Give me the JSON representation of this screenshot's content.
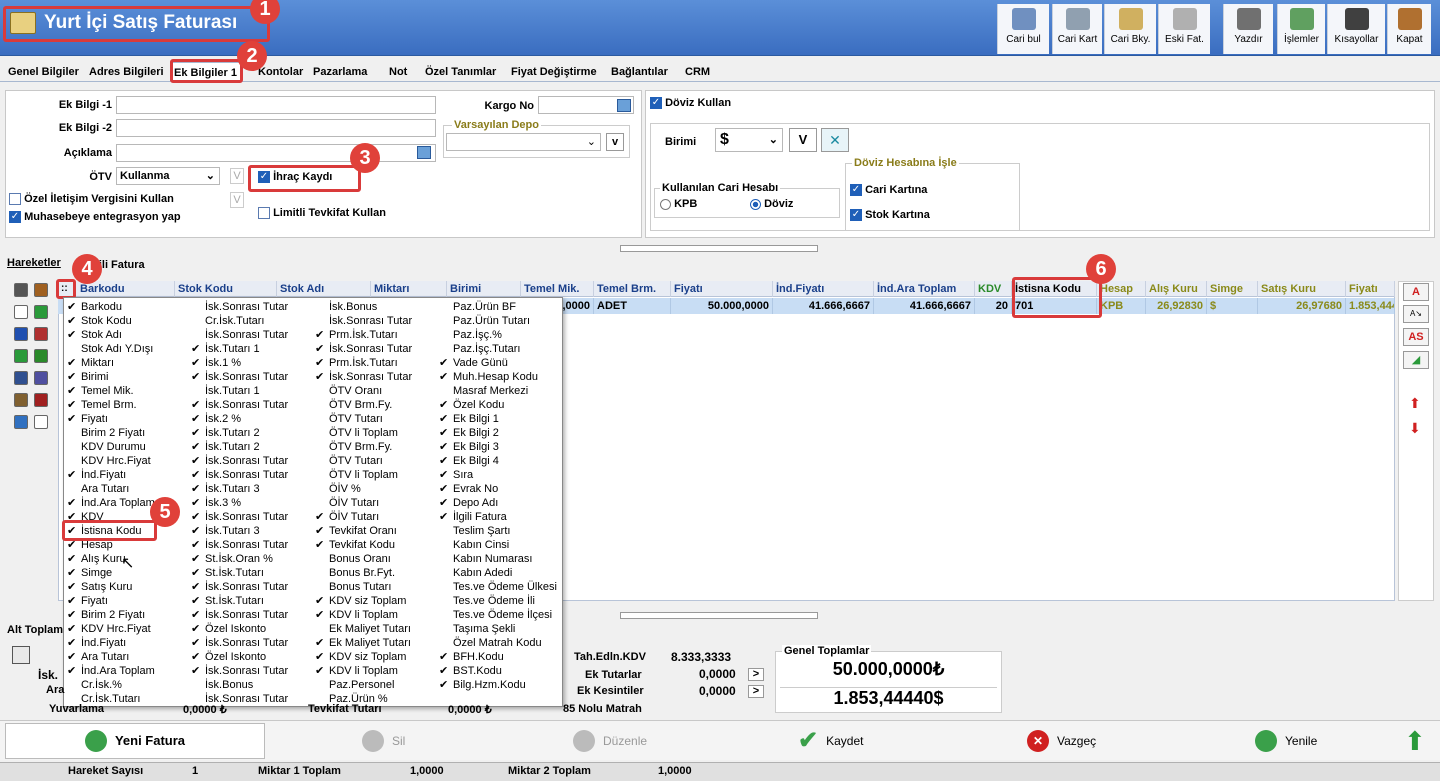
{
  "window": {
    "title": "Yurt İçi Satış Faturası"
  },
  "toolbar": [
    {
      "label": "Cari bul",
      "icon": "user-search-icon"
    },
    {
      "label": "Cari Kart",
      "icon": "users-icon"
    },
    {
      "label": "Cari Bky.",
      "icon": "document-user-icon"
    },
    {
      "label": "Eski Fat.",
      "icon": "old-invoice-icon"
    },
    {
      "label": "Yazdır",
      "icon": "printer-icon"
    },
    {
      "label": "İşlemler",
      "icon": "operations-icon"
    },
    {
      "label": "Kısayollar",
      "icon": "keyboard-icon"
    },
    {
      "label": "Kapat",
      "icon": "door-icon"
    }
  ],
  "tabs": [
    "Genel Bilgiler",
    "Adres Bilgileri",
    "Ek Bilgiler 1",
    "Kontolar",
    "Pazarlama",
    "Not",
    "Özel Tanımlar",
    "Fiyat Değiştirme",
    "Bağlantılar",
    "CRM"
  ],
  "form": {
    "ek1": "Ek Bilgi -1",
    "ek2": "Ek Bilgi -2",
    "aciklama": "Açıklama",
    "otv": "ÖTV",
    "otv_value": "Kullanma",
    "ozel": "Özel İletişim Vergisini Kullan",
    "muh": "Muhasebeye entegrasyon yap",
    "ihrac": "İhraç Kaydı",
    "limitli": "Limitli Tevkifat Kullan",
    "kargo": "Kargo No",
    "depo": "Varsayılan Depo",
    "v": "V",
    "vlow": "v"
  },
  "doviz": {
    "title": "Döviz Kullan",
    "birimi": "Birimi",
    "currency": "$",
    "kullanilan": "Kullanılan Cari Hesabı",
    "kpb": "KPB",
    "doviz": "Döviz",
    "hesaba": "Döviz Hesabına İşle",
    "cari": "Cari Kartına",
    "stok": "Stok Kartına"
  },
  "section": {
    "hareketler": "Hareketler",
    "ilgili": "İlgili Fatura",
    "alt": "Alt Toplam"
  },
  "grid": {
    "headers": [
      "Barkodu",
      "Stok Kodu",
      "Stok Adı",
      "Miktarı",
      "Birimi",
      "Temel Mik.",
      "Temel Brm.",
      "Fiyatı",
      "İnd.Fiyatı",
      "İnd.Ara Toplam",
      "KDV",
      "İstisna Kodu",
      "Hesap",
      "Alış Kuru",
      "Simge",
      "Satış Kuru",
      "Fiyatı"
    ],
    "row": [
      "1,0000",
      "ADET",
      "50.000,0000",
      "41.666,6667",
      "41.666,6667",
      "20",
      "701",
      "KPB",
      "26,92830",
      "$",
      "26,97680",
      "1.853,444"
    ]
  },
  "menu": {
    "col1": [
      {
        "t": "Barkodu",
        "c": true
      },
      {
        "t": "Stok Kodu",
        "c": true
      },
      {
        "t": "Stok Adı",
        "c": true
      },
      {
        "t": "Stok Adı Y.Dışı",
        "c": false
      },
      {
        "t": "Miktarı",
        "c": true
      },
      {
        "t": "Birimi",
        "c": true
      },
      {
        "t": "Temel Mik.",
        "c": true
      },
      {
        "t": "Temel Brm.",
        "c": true
      },
      {
        "t": "Fiyatı",
        "c": true
      },
      {
        "t": "Birim 2 Fiyatı",
        "c": false
      },
      {
        "t": "KDV Durumu",
        "c": false
      },
      {
        "t": "KDV Hrc.Fiyat",
        "c": false
      },
      {
        "t": "İnd.Fiyatı",
        "c": true
      },
      {
        "t": "Ara Tutarı",
        "c": false
      },
      {
        "t": "İnd.Ara Toplam",
        "c": true
      },
      {
        "t": "KDV",
        "c": true
      },
      {
        "t": "İstisna Kodu",
        "c": true
      },
      {
        "t": "Hesap",
        "c": true
      },
      {
        "t": "Alış Kuru",
        "c": true
      },
      {
        "t": "Simge",
        "c": true
      },
      {
        "t": "Satış Kuru",
        "c": true
      },
      {
        "t": "Fiyatı",
        "c": true
      },
      {
        "t": "Birim 2 Fiyatı",
        "c": true
      },
      {
        "t": "KDV Hrc.Fiyat",
        "c": true
      },
      {
        "t": "İnd.Fiyatı",
        "c": true
      },
      {
        "t": "Ara Tutarı",
        "c": true
      },
      {
        "t": "İnd.Ara Toplam",
        "c": true
      },
      {
        "t": "Cr.İsk.%",
        "c": false
      },
      {
        "t": "Cr.İsk.Tutarı",
        "c": false
      }
    ],
    "col2": [
      {
        "t": "İsk.Sonrası Tutar",
        "c": false
      },
      {
        "t": "Cr.İsk.Tutarı",
        "c": false
      },
      {
        "t": "İsk.Sonrası Tutar",
        "c": false
      },
      {
        "t": "İsk.Tutarı 1",
        "c": true
      },
      {
        "t": "İsk.1 %",
        "c": true
      },
      {
        "t": "İsk.Sonrası Tutar",
        "c": true
      },
      {
        "t": "İsk.Tutarı 1",
        "c": false
      },
      {
        "t": "İsk.Sonrası Tutar",
        "c": true
      },
      {
        "t": "İsk.2 %",
        "c": true
      },
      {
        "t": "İsk.Tutarı 2",
        "c": true
      },
      {
        "t": "İsk.Tutarı 2",
        "c": true
      },
      {
        "t": "İsk.Sonrası Tutar",
        "c": true
      },
      {
        "t": "İsk.Sonrası Tutar",
        "c": true
      },
      {
        "t": "İsk.Tutarı 3",
        "c": true
      },
      {
        "t": "İsk.3 %",
        "c": true
      },
      {
        "t": "İsk.Sonrası Tutar",
        "c": true
      },
      {
        "t": "İsk.Tutarı 3",
        "c": true
      },
      {
        "t": "İsk.Sonrası Tutar",
        "c": true
      },
      {
        "t": "St.İsk.Oran %",
        "c": true
      },
      {
        "t": "St.İsk.Tutarı",
        "c": true
      },
      {
        "t": "İsk.Sonrası Tutar",
        "c": true
      },
      {
        "t": "St.İsk.Tutarı",
        "c": true
      },
      {
        "t": "İsk.Sonrası Tutar",
        "c": true
      },
      {
        "t": "Özel Iskonto",
        "c": true
      },
      {
        "t": "İsk.Sonrası Tutar",
        "c": true
      },
      {
        "t": "Özel Iskonto",
        "c": true
      },
      {
        "t": "İsk.Sonrası Tutar",
        "c": true
      },
      {
        "t": "İsk.Bonus",
        "c": false
      },
      {
        "t": "İsk.Sonrası Tutar",
        "c": false
      }
    ],
    "col3": [
      {
        "t": "İsk.Bonus",
        "c": false
      },
      {
        "t": "İsk.Sonrası Tutar",
        "c": false
      },
      {
        "t": "Prm.İsk.Tutarı",
        "c": true
      },
      {
        "t": "İsk.Sonrası Tutar",
        "c": true
      },
      {
        "t": "Prm.İsk.Tutarı",
        "c": true
      },
      {
        "t": "İsk.Sonrası Tutar",
        "c": true
      },
      {
        "t": "ÖTV Oranı",
        "c": false
      },
      {
        "t": "ÖTV Brm.Fy.",
        "c": false
      },
      {
        "t": "ÖTV Tutarı",
        "c": false
      },
      {
        "t": "ÖTV li Toplam",
        "c": false
      },
      {
        "t": "ÖTV Brm.Fy.",
        "c": false
      },
      {
        "t": "ÖTV Tutarı",
        "c": false
      },
      {
        "t": "ÖTV li Toplam",
        "c": false
      },
      {
        "t": "ÖİV %",
        "c": false
      },
      {
        "t": "ÖİV Tutarı",
        "c": false
      },
      {
        "t": "ÖİV Tutarı",
        "c": true
      },
      {
        "t": "Tevkifat Oranı",
        "c": true
      },
      {
        "t": "Tevkifat Kodu",
        "c": true
      },
      {
        "t": "Bonus Oranı",
        "c": false
      },
      {
        "t": "Bonus Br.Fyt.",
        "c": false
      },
      {
        "t": "Bonus Tutarı",
        "c": false
      },
      {
        "t": "KDV siz Toplam",
        "c": true
      },
      {
        "t": "KDV li Toplam",
        "c": true
      },
      {
        "t": "Ek Maliyet Tutarı",
        "c": false
      },
      {
        "t": "Ek Maliyet Tutarı",
        "c": true
      },
      {
        "t": "KDV siz Toplam",
        "c": true
      },
      {
        "t": "KDV li Toplam",
        "c": true
      },
      {
        "t": "Paz.Personel",
        "c": false
      },
      {
        "t": "Paz.Ürün %",
        "c": false
      }
    ],
    "col4": [
      {
        "t": "Paz.Ürün BF",
        "c": false
      },
      {
        "t": "Paz.Ürün Tutarı",
        "c": false
      },
      {
        "t": "Paz.İşç.%",
        "c": false
      },
      {
        "t": "Paz.İşç.Tutarı",
        "c": false
      },
      {
        "t": "Vade Günü",
        "c": true
      },
      {
        "t": "Muh.Hesap Kodu",
        "c": true
      },
      {
        "t": "Masraf Merkezi",
        "c": false
      },
      {
        "t": "Özel Kodu",
        "c": true
      },
      {
        "t": "Ek Bilgi 1",
        "c": true
      },
      {
        "t": "Ek Bilgi 2",
        "c": true
      },
      {
        "t": "Ek Bilgi 3",
        "c": true
      },
      {
        "t": "Ek Bilgi 4",
        "c": true
      },
      {
        "t": "Sıra",
        "c": true
      },
      {
        "t": "Evrak No",
        "c": true
      },
      {
        "t": "Depo Adı",
        "c": true
      },
      {
        "t": "İlgili Fatura",
        "c": true
      },
      {
        "t": "Teslim Şartı",
        "c": false
      },
      {
        "t": "Kabın Cinsi",
        "c": false
      },
      {
        "t": "Kabın Numarası",
        "c": false
      },
      {
        "t": "Kabın Adedi",
        "c": false
      },
      {
        "t": "Tes.ve Ödeme Ülkesi",
        "c": false
      },
      {
        "t": "Tes.ve Ödeme İli",
        "c": false
      },
      {
        "t": "Tes.ve Ödeme İlçesi",
        "c": false
      },
      {
        "t": "Taşıma Şekli",
        "c": false
      },
      {
        "t": "Özel Matrah Kodu",
        "c": false
      },
      {
        "t": "BFH.Kodu",
        "c": true
      },
      {
        "t": "BST.Kodu",
        "c": true
      },
      {
        "t": "Bilg.Hzm.Kodu",
        "c": true
      }
    ]
  },
  "totals": {
    "isk": "İsk.",
    "ara": "Ara",
    "yuvarlama": "Yuvarlama",
    "yuvarlama_val": "0,0000 ₺",
    "tevkifat": "Tevkifat Tutarı",
    "tevkifat_val": "0,0000 ₺",
    "tah_lbl": "Tah.Edln.KDV",
    "tah_val": "8.333,3333",
    "ek_tut_lbl": "Ek Tutarlar",
    "ek_tut_val": "0,0000",
    "ek_kes_lbl": "Ek Kesintiler",
    "ek_kes_val": "0,0000",
    "matrah": "85 Nolu Matrah",
    "genel": "Genel Toplamlar",
    "genel_tl": "50.000,0000₺",
    "genel_usd": "1.853,44440$"
  },
  "buttons": {
    "yeni": "Yeni Fatura",
    "sil": "Sil",
    "duzenle": "Düzenle",
    "kaydet": "Kaydet",
    "vazgec": "Vazgeç",
    "yenile": "Yenile"
  },
  "status": {
    "hs_lbl": "Hareket Sayısı",
    "hs_val": "1",
    "m1_lbl": "Miktar 1 Toplam",
    "m1_val": "1,0000",
    "m2_lbl": "Miktar 2 Toplam",
    "m2_val": "1,0000"
  },
  "side_buttons": [
    "A",
    "AS"
  ],
  "badges": [
    "1",
    "2",
    "3",
    "4",
    "5",
    "6"
  ],
  "colors": {
    "title_bar": "#3a6dc0",
    "selected_row": "#c8ddf4",
    "annotation": "#e0413a"
  }
}
